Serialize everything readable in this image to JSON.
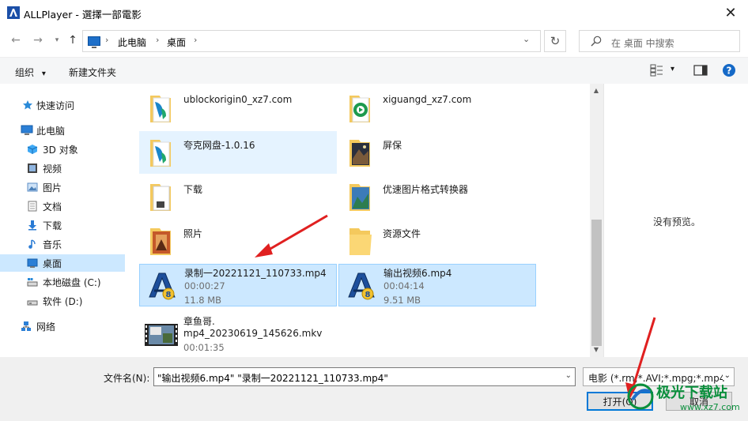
{
  "window": {
    "title": "ALLPlayer - 選擇一部電影",
    "close_glyph": "✕"
  },
  "nav": {
    "back_glyph": "←",
    "forward_glyph": "→",
    "up_glyph": "↑",
    "breadcrumb": [
      "此电脑",
      "桌面"
    ],
    "breadcrumb_sep": "›",
    "refresh_glyph": "↻",
    "search_placeholder": "在 桌面 中搜索"
  },
  "toolbar": {
    "organize_label": "组织",
    "organize_caret": "▾",
    "new_folder_label": "新建文件夹",
    "view_caret": "▾",
    "help_glyph": "?"
  },
  "sidebar": {
    "items": [
      {
        "label": "快速访问",
        "icon": "star-icon"
      },
      {
        "label": "此电脑",
        "icon": "computer-icon"
      },
      {
        "label": "3D 对象",
        "icon": "cube-icon"
      },
      {
        "label": "视频",
        "icon": "video-icon"
      },
      {
        "label": "图片",
        "icon": "picture-icon"
      },
      {
        "label": "文档",
        "icon": "document-icon"
      },
      {
        "label": "下载",
        "icon": "download-icon"
      },
      {
        "label": "音乐",
        "icon": "music-icon"
      },
      {
        "label": "桌面",
        "icon": "desktop-icon",
        "selected": true
      },
      {
        "label": "本地磁盘 (C:)",
        "icon": "drive-icon"
      },
      {
        "label": "软件 (D:)",
        "icon": "drive-icon"
      },
      {
        "label": "网络",
        "icon": "network-icon"
      }
    ]
  },
  "files": [
    {
      "name": "ublockorigin0_xz7.com",
      "type": "folder-app"
    },
    {
      "name": "xiguangd_xz7.com",
      "type": "folder-app"
    },
    {
      "name": "夸克网盘-1.0.16",
      "type": "folder-app"
    },
    {
      "name": "屏保",
      "type": "folder-image"
    },
    {
      "name": "下载",
      "type": "folder-doc"
    },
    {
      "name": "优速图片格式转换器",
      "type": "folder-image"
    },
    {
      "name": "照片",
      "type": "folder-photo"
    },
    {
      "name": "资源文件",
      "type": "folder"
    },
    {
      "name": "录制一20221121_110733.mp4",
      "duration": "00:00:27",
      "size": "11.8 MB",
      "type": "video",
      "selected": true
    },
    {
      "name": "输出视频6.mp4",
      "duration": "00:04:14",
      "size": "9.51 MB",
      "type": "video",
      "selected": true
    },
    {
      "name": "章鱼哥.",
      "name2": "mp4_20230619_145626.mkv",
      "duration": "00:01:35",
      "type": "mkv"
    }
  ],
  "preview": {
    "empty_text": "没有预览。"
  },
  "scrollbar": {
    "up_glyph": "▲",
    "down_glyph": "▼"
  },
  "bottom": {
    "filename_label": "文件名(N):",
    "filename_value": "\"输出视频6.mp4\" \"录制一20221121_110733.mp4\"",
    "filter_value": "电影 (*.rm;*.AVI;*.mpg;*.mp4",
    "dropdown_glyph": "⌄",
    "open_label": "打开(O)",
    "cancel_label": "取消"
  },
  "watermark": {
    "text": "极光下载站",
    "sub": "www.xz7.com"
  },
  "colors": {
    "selection": "#cce8ff",
    "accent": "#0078d7",
    "annotation_arrow": "#e02020",
    "folder": "#f4c95d"
  }
}
